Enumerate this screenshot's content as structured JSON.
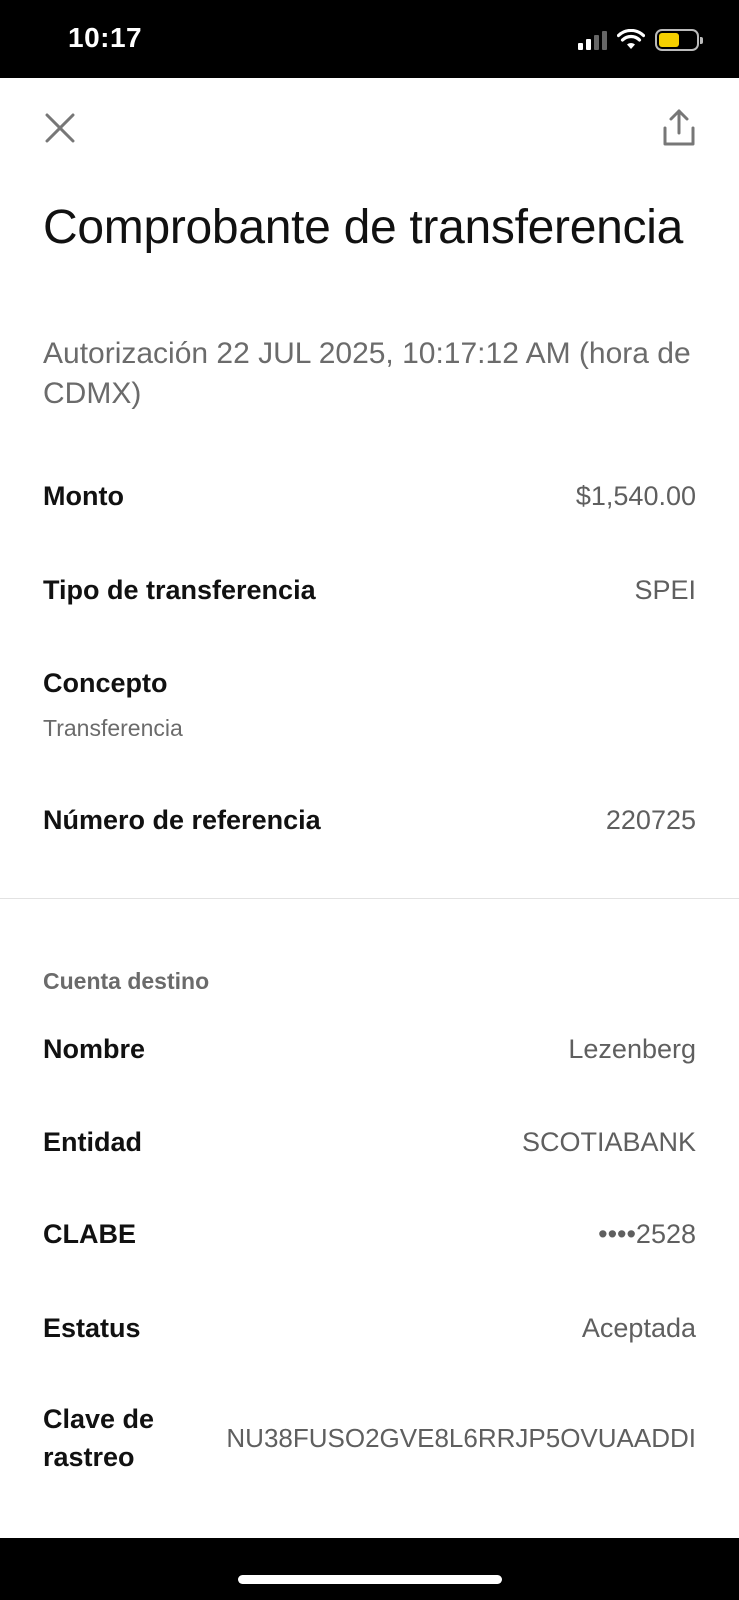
{
  "status_bar": {
    "time": "10:17"
  },
  "header": {
    "title": "Comprobante de transferencia",
    "subtitle": "Autorización 22 JUL 2025, 10:17:12 AM (hora de CDMX)"
  },
  "details": {
    "monto": {
      "label": "Monto",
      "value": "$1,540.00"
    },
    "tipo": {
      "label": "Tipo de transferencia",
      "value": "SPEI"
    },
    "concepto": {
      "label": "Concepto",
      "value": "Transferencia"
    },
    "referencia": {
      "label": "Número de referencia",
      "value": "220725"
    }
  },
  "destino": {
    "section_label": "Cuenta destino",
    "nombre": {
      "label": "Nombre",
      "value": "Lezenberg"
    },
    "entidad": {
      "label": "Entidad",
      "value": "SCOTIABANK"
    },
    "clabe": {
      "label": "CLABE",
      "value": "••••2528"
    },
    "estatus": {
      "label": "Estatus",
      "value": "Aceptada"
    },
    "clave": {
      "label_line1": "Clave de",
      "label_line2": "rastreo",
      "value": "NU38FUSO2GVE8L6RRJP5OVUAADDI"
    }
  },
  "icons": {
    "close": "close-icon",
    "share": "share-icon",
    "signal": "signal-icon",
    "wifi": "wifi-icon",
    "battery": "battery-icon"
  },
  "colors": {
    "battery_fill": "#f5d000",
    "label_text": "#111111",
    "value_text": "#5f5f5f"
  }
}
